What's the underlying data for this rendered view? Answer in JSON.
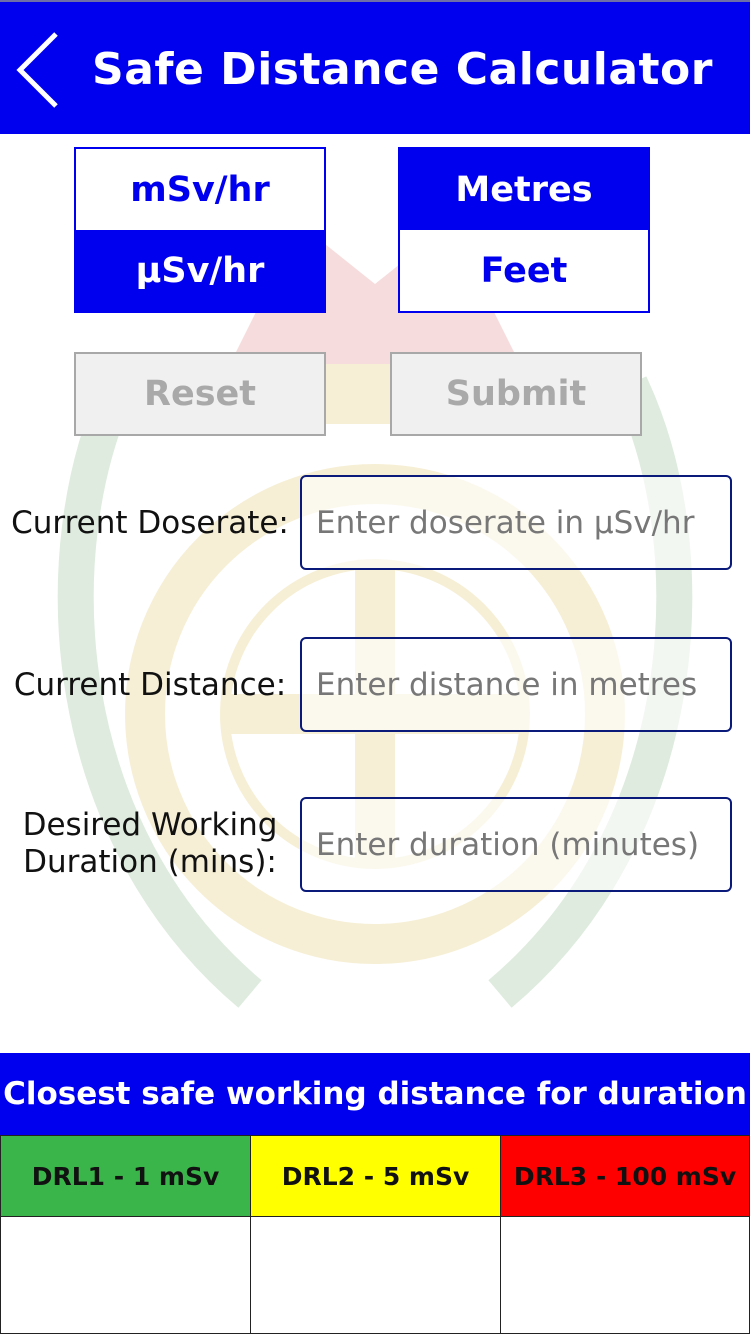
{
  "header": {
    "title": "Safe Distance Calculator",
    "back_icon": "chevron-left-icon"
  },
  "units": {
    "dose_options": [
      {
        "label": "mSv/hr",
        "selected": false
      },
      {
        "label": "μSv/hr",
        "selected": true
      }
    ],
    "distance_options": [
      {
        "label": "Metres",
        "selected": true
      },
      {
        "label": "Feet",
        "selected": false
      }
    ]
  },
  "actions": {
    "reset_label": "Reset",
    "submit_label": "Submit"
  },
  "form": {
    "doserate": {
      "label": "Current Doserate:",
      "value": "",
      "placeholder": "Enter doserate in μSv/hr"
    },
    "distance": {
      "label": "Current Distance:",
      "value": "",
      "placeholder": "Enter distance in metres"
    },
    "duration": {
      "label_line1": "Desired Working",
      "label_line2": "Duration (mins):",
      "value": "",
      "placeholder": "Enter duration (minutes)"
    }
  },
  "results": {
    "title": "Closest safe working distance for duration",
    "columns": [
      {
        "label": "DRL1 - 1 mSv",
        "color": "#3ab54a",
        "value": ""
      },
      {
        "label": "DRL2 - 5 mSv",
        "color": "#ffff00",
        "value": ""
      },
      {
        "label": "DRL3 - 100 mSv",
        "color": "#ff0000",
        "value": ""
      }
    ]
  },
  "colors": {
    "primary": "#0000ee",
    "button_disabled_bg": "#f0f0f0",
    "button_disabled_text": "#a9a9a9"
  }
}
